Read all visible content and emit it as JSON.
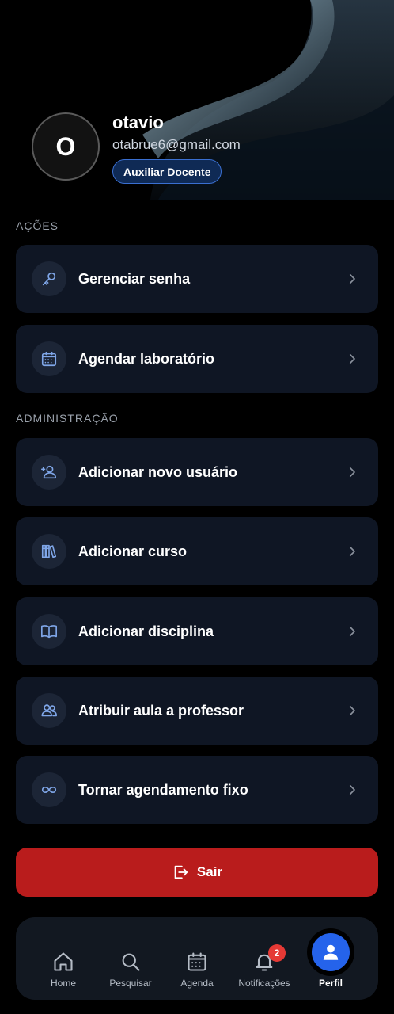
{
  "profile": {
    "initial": "O",
    "name": "otavio",
    "email": "otabrue6@gmail.com",
    "role": "Auxiliar Docente"
  },
  "sections": {
    "actions_title": "AÇÕES",
    "admin_title": "ADMINISTRAÇÃO"
  },
  "actions": [
    {
      "label": "Gerenciar senha",
      "icon": "key-icon"
    },
    {
      "label": "Agendar laboratório",
      "icon": "calendar-icon"
    }
  ],
  "admin": [
    {
      "label": "Adicionar novo usuário",
      "icon": "user-plus-icon"
    },
    {
      "label": "Adicionar curso",
      "icon": "books-icon"
    },
    {
      "label": "Adicionar disciplina",
      "icon": "book-open-icon"
    },
    {
      "label": "Atribuir aula a professor",
      "icon": "users-icon"
    },
    {
      "label": "Tornar agendamento fixo",
      "icon": "infinity-icon"
    }
  ],
  "logout": {
    "label": "Sair"
  },
  "nav": {
    "home": "Home",
    "search": "Pesquisar",
    "agenda": "Agenda",
    "notifications": "Notificações",
    "notifications_count": "2",
    "profile": "Perfil"
  },
  "colors": {
    "accent": "#2563eb",
    "danger": "#b91c1c",
    "card": "#0f1624",
    "badge": "#e53935"
  }
}
